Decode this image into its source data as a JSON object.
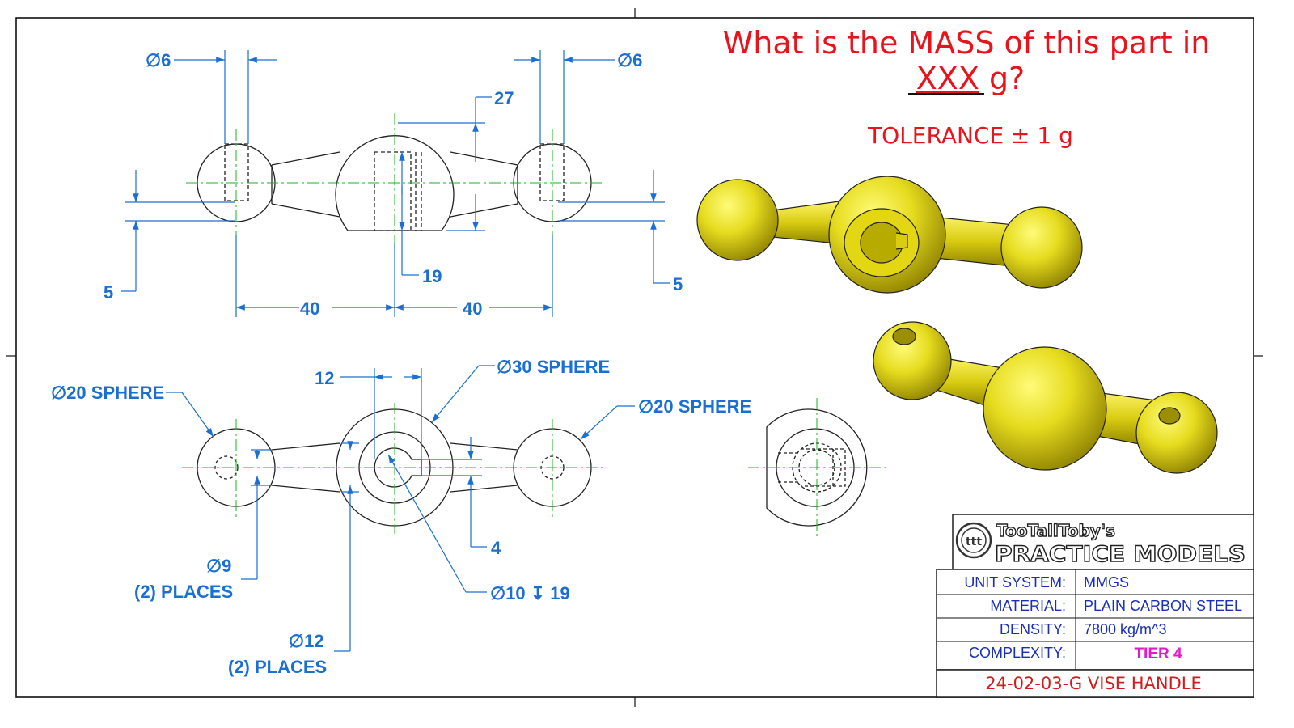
{
  "question": {
    "line1": "What is the MASS of this part in",
    "line2_underlined": "XXX",
    "line2_rest": " g?",
    "tolerance": "TOLERANCE ± 1 g"
  },
  "top_view": {
    "dim_hole_left": "∅6",
    "dim_hole_right": "∅6",
    "dim_height": "27",
    "dim_depth": "19",
    "dim_offset_left": "5",
    "dim_offset_right": "5",
    "dim_span_left": "40",
    "dim_span_right": "40"
  },
  "front_view": {
    "dim_key_width": "12",
    "dim_center_sphere": "∅30 SPHERE",
    "dim_left_sphere": "∅20 SPHERE",
    "dim_right_sphere": "∅20 SPHERE",
    "dim_small_hole": "∅9",
    "dim_small_hole_note": "(2) PLACES",
    "dim_key_offset": "4",
    "dim_bore": "∅10 ↧ 19",
    "dim_neck": "∅12",
    "dim_neck_note": "(2) PLACES"
  },
  "title_block": {
    "brand_line1": "TooTallToby's",
    "brand_line2": "PRACTICE MODELS",
    "logo_text": "ttt",
    "rows": [
      {
        "label": "UNIT SYSTEM:",
        "value": "MMGS"
      },
      {
        "label": "MATERIAL:",
        "value": "PLAIN CARBON STEEL"
      },
      {
        "label": "DENSITY:",
        "value": "7800 kg/m^3"
      },
      {
        "label": "COMPLEXITY:",
        "value": "TIER 4"
      }
    ],
    "part_name": "24-02-03-G VISE HANDLE"
  },
  "colors": {
    "dimension_blue": "#1a6fd1",
    "centerline_green": "#19b619",
    "question_red": "#e8141c",
    "part_yellow": "#e6dc1e",
    "complexity_pink": "#e619c8"
  }
}
